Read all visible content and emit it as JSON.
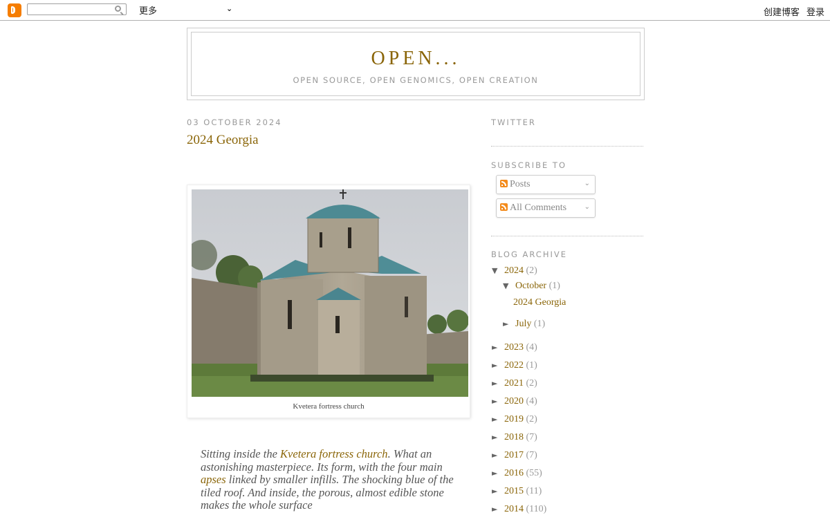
{
  "navbar": {
    "search_value": "",
    "more_label": "更多",
    "create_label": "创建博客",
    "login_label": "登录"
  },
  "header": {
    "title": "OPEN...",
    "description": "Open source, open genomics, open creation"
  },
  "post": {
    "date": "03 October 2024",
    "title": "2024 Georgia",
    "image_caption": "Kvetera fortress church",
    "body": {
      "p1_before": "Sitting inside the ",
      "p1_link1": "Kvetera fortress church",
      "p1_mid": ".  What an astonishing masterpiece.  Its form, with the four main ",
      "p1_link2": "apses",
      "p1_after": " linked by smaller infills.  The shocking blue of the tiled roof.  And inside, the porous, almost edible stone makes the whole surface"
    }
  },
  "sidebar": {
    "twitter_heading": "Twitter",
    "subscribe_heading": "Subscribe To",
    "subscribe_posts": "Posts",
    "subscribe_comments": "All Comments",
    "archive_heading": "Blog Archive",
    "archive": {
      "y2024": {
        "year": "2024",
        "count": "(2)",
        "toggle": "▼"
      },
      "oct": {
        "month": "October",
        "count": "(1)",
        "toggle": "▼"
      },
      "oct_post": "2024 Georgia",
      "jul": {
        "month": "July",
        "count": "(1)",
        "toggle": "►"
      },
      "years": [
        {
          "year": "2023",
          "count": "(4)"
        },
        {
          "year": "2022",
          "count": "(1)"
        },
        {
          "year": "2021",
          "count": "(2)"
        },
        {
          "year": "2020",
          "count": "(4)"
        },
        {
          "year": "2019",
          "count": "(2)"
        },
        {
          "year": "2018",
          "count": "(7)"
        },
        {
          "year": "2017",
          "count": "(7)"
        },
        {
          "year": "2016",
          "count": "(55)"
        },
        {
          "year": "2015",
          "count": "(11)"
        },
        {
          "year": "2014",
          "count": "(110)"
        }
      ]
    }
  },
  "colors": {
    "accent": "#8a6508",
    "muted": "#999999",
    "roof_blue": "#4d8a93"
  }
}
